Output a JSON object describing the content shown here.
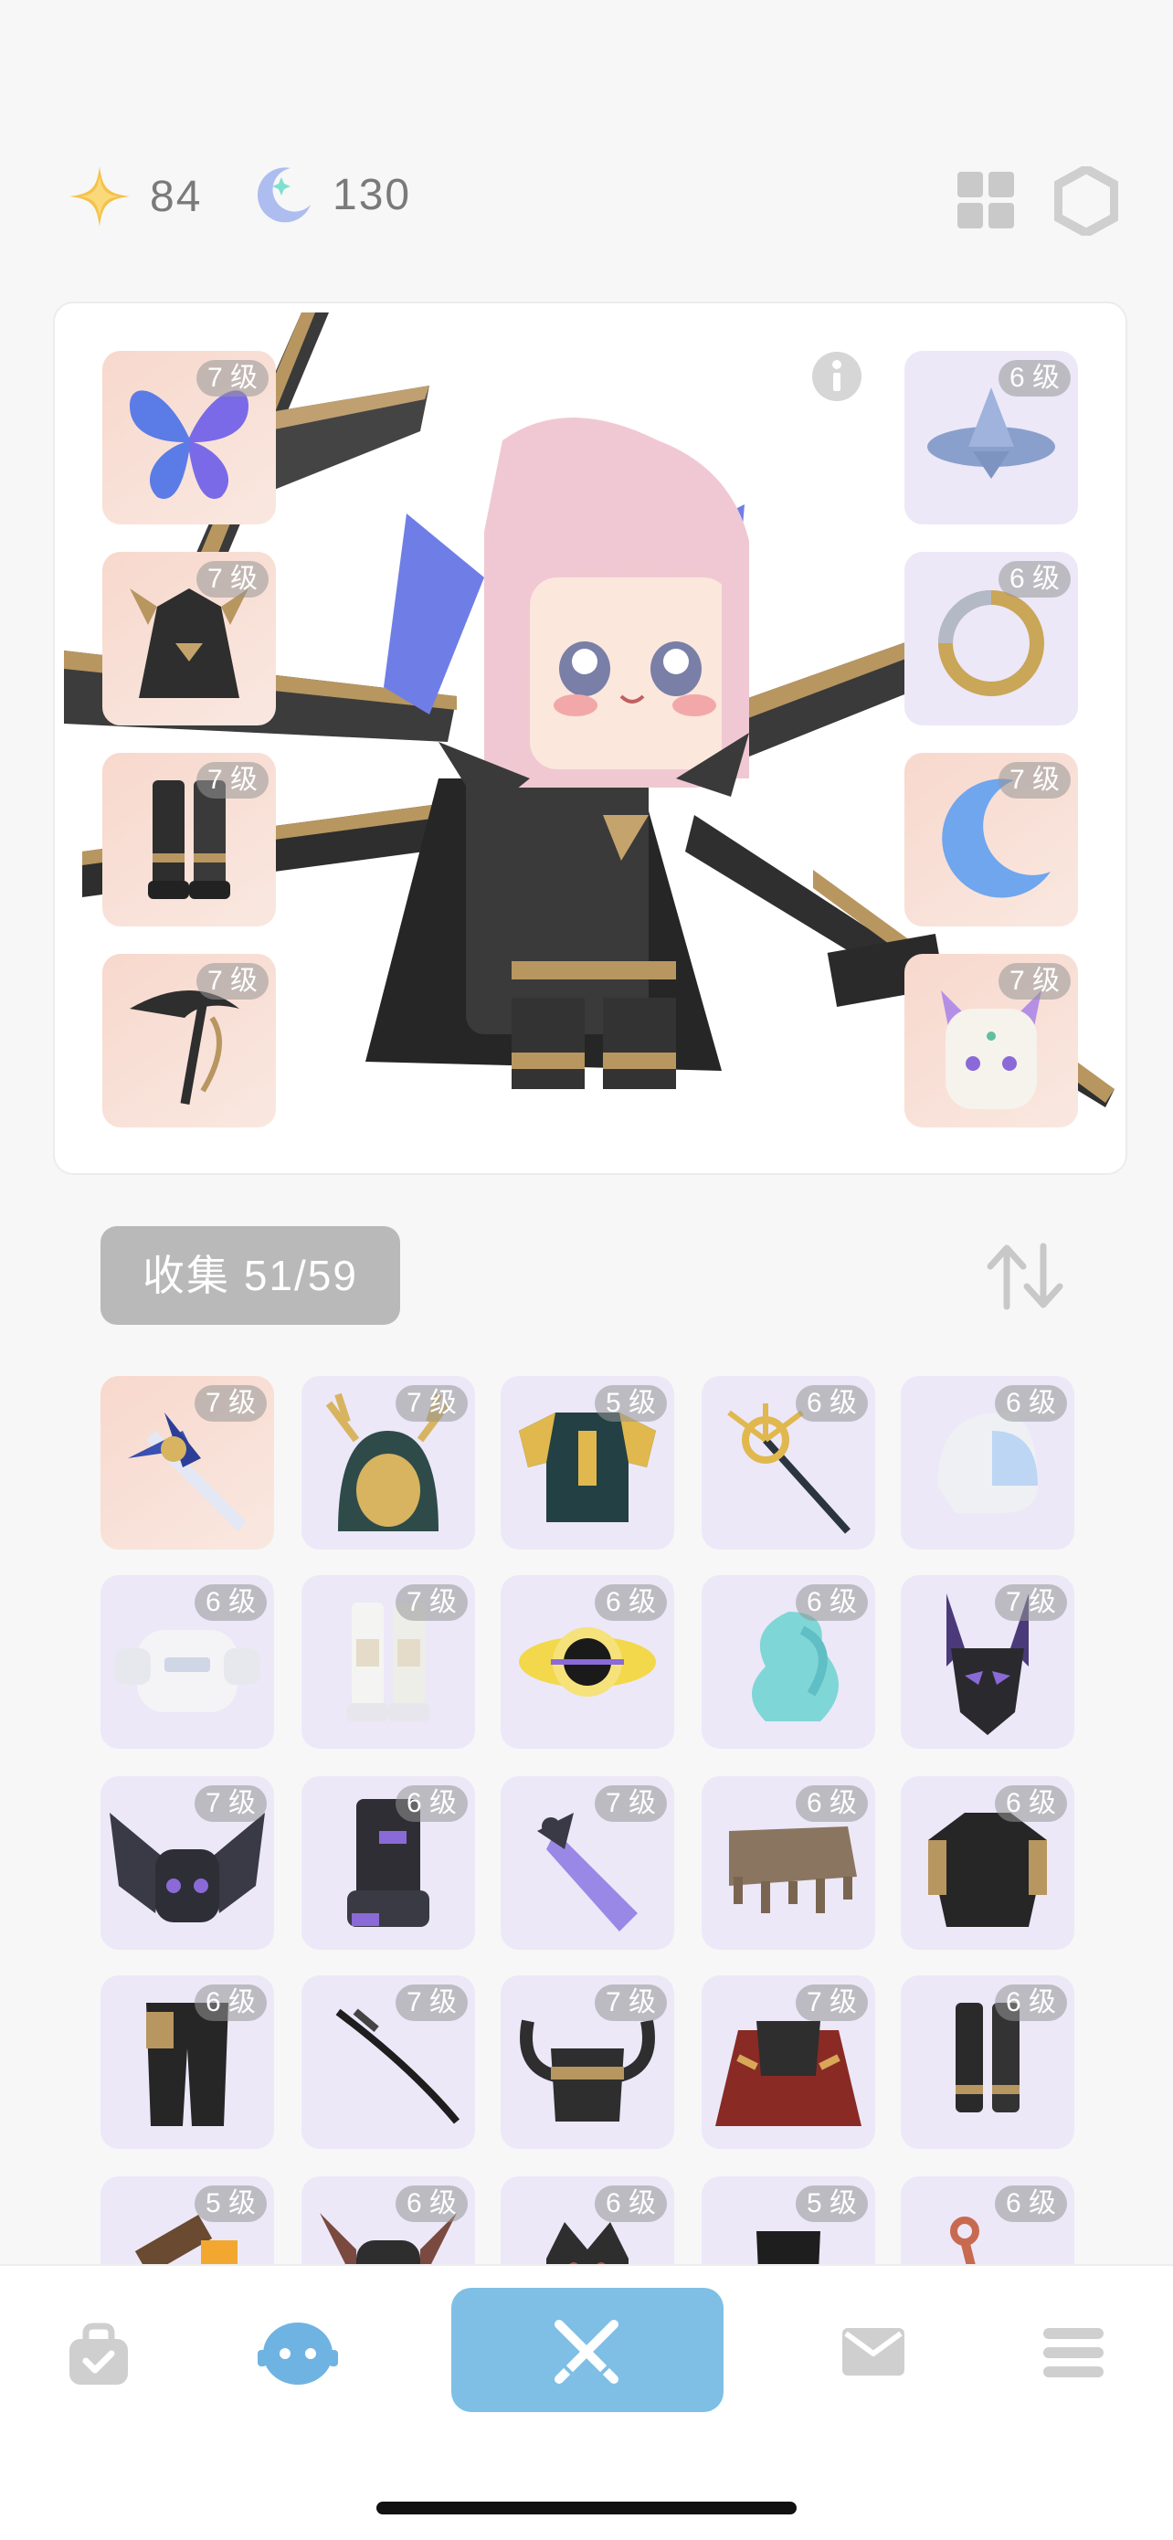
{
  "currency": {
    "stars": {
      "icon": "star-icon",
      "value": "84"
    },
    "moons": {
      "icon": "moon-icon",
      "value": "130"
    }
  },
  "top_actions": [
    {
      "icon": "grid-icon"
    },
    {
      "icon": "hexagon-icon"
    }
  ],
  "character": {
    "info_icon": "info-icon",
    "left_slots": [
      {
        "badge": "7 级",
        "icon": "butterfly-wings-icon",
        "tone": "peach"
      },
      {
        "badge": "7 级",
        "icon": "dark-armor-icon",
        "tone": "peach"
      },
      {
        "badge": "7 级",
        "icon": "dark-boots-icon",
        "tone": "peach"
      },
      {
        "badge": "7 级",
        "icon": "scythe-icon",
        "tone": "peach"
      }
    ],
    "right_slots": [
      {
        "badge": "6 级",
        "icon": "spinning-top-icon",
        "tone": "lav"
      },
      {
        "badge": "6 级",
        "icon": "serpent-ring-icon",
        "tone": "lav"
      },
      {
        "badge": "7 级",
        "icon": "crescent-moon-icon",
        "tone": "peach"
      },
      {
        "badge": "7 级",
        "icon": "cat-mask-icon",
        "tone": "peach"
      }
    ]
  },
  "collection": {
    "label": "收集 51/59",
    "sort_icon": "sort-arrows-icon",
    "items": [
      {
        "badge": "7 级",
        "icon": "magic-sword-icon",
        "tone": "peach"
      },
      {
        "badge": "7 级",
        "icon": "antler-hood-icon",
        "tone": "lav"
      },
      {
        "badge": "5 级",
        "icon": "emblem-shirt-icon",
        "tone": "lav"
      },
      {
        "badge": "6 级",
        "icon": "golden-staff-icon",
        "tone": "lav"
      },
      {
        "badge": "6 级",
        "icon": "helmet-icon",
        "tone": "lav"
      },
      {
        "badge": "6 级",
        "icon": "robot-armor-icon",
        "tone": "lav"
      },
      {
        "badge": "7 级",
        "icon": "white-boots-icon",
        "tone": "lav"
      },
      {
        "badge": "6 级",
        "icon": "eclipse-icon",
        "tone": "lav"
      },
      {
        "badge": "6 级",
        "icon": "klein-bottle-icon",
        "tone": "lav"
      },
      {
        "badge": "7 级",
        "icon": "demon-mask-icon",
        "tone": "lav"
      },
      {
        "badge": "7 级",
        "icon": "bat-wing-armor-icon",
        "tone": "lav"
      },
      {
        "badge": "6 级",
        "icon": "dark-gauntlet-icon",
        "tone": "lav"
      },
      {
        "badge": "7 级",
        "icon": "crystal-sword-icon",
        "tone": "lav"
      },
      {
        "badge": "6 级",
        "icon": "table-cloth-icon",
        "tone": "lav"
      },
      {
        "badge": "6 级",
        "icon": "dark-coat-icon",
        "tone": "lav"
      },
      {
        "badge": "6 级",
        "icon": "dark-pants-icon",
        "tone": "lav"
      },
      {
        "badge": "7 级",
        "icon": "katana-icon",
        "tone": "lav"
      },
      {
        "badge": "7 级",
        "icon": "horned-helmet-icon",
        "tone": "lav"
      },
      {
        "badge": "7 级",
        "icon": "red-cape-icon",
        "tone": "lav"
      },
      {
        "badge": "6 级",
        "icon": "dark-boots-icon",
        "tone": "lav"
      },
      {
        "badge": "5 级",
        "icon": "hammer-icon",
        "tone": "lav"
      },
      {
        "badge": "6 级",
        "icon": "bat-hood-icon",
        "tone": "lav"
      },
      {
        "badge": "6 级",
        "icon": "crown-mask-icon",
        "tone": "lav"
      },
      {
        "badge": "5 级",
        "icon": "black-pants-icon",
        "tone": "lav"
      },
      {
        "badge": "6 级",
        "icon": "anchor-icon",
        "tone": "lav"
      }
    ]
  },
  "nav": [
    {
      "icon": "bag-icon"
    },
    {
      "icon": "avatar-icon"
    },
    {
      "icon": "crossed-swords-icon"
    },
    {
      "icon": "mail-icon"
    },
    {
      "icon": "menu-icon"
    }
  ],
  "colors": {
    "accent": "#7fbfe6",
    "peach": "#f8d8cd",
    "lavender": "#ece8f8",
    "badge": "#9a9a9a"
  }
}
